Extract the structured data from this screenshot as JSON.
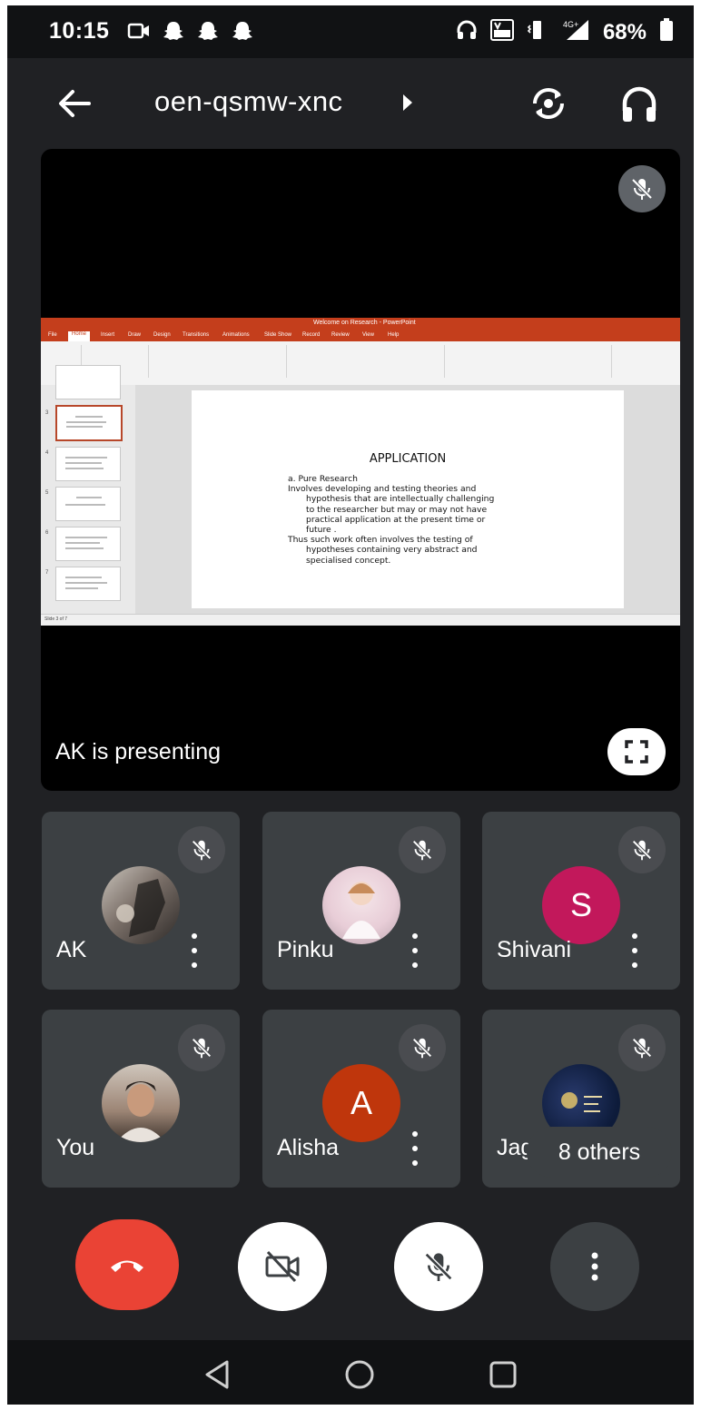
{
  "status_bar": {
    "time": "10:15",
    "battery": "68%",
    "network": "4G+",
    "icons_left": [
      "video-notification-icon",
      "snapchat-icon",
      "snapchat-icon",
      "snapchat-icon"
    ],
    "icons_right": [
      "headset-icon",
      "volte-icon",
      "vibrate-icon",
      "signal-icon",
      "battery-icon"
    ]
  },
  "top_bar": {
    "meeting_code": "oen-qsmw-xnc"
  },
  "presentation": {
    "presenter_label": "AK is presenting",
    "screen": {
      "app_title": "Welcome on Research - PowerPoint",
      "tabs": [
        "File",
        "Home",
        "Insert",
        "Draw",
        "Design",
        "Transitions",
        "Animations",
        "Slide Show",
        "Record",
        "Review",
        "View",
        "Help"
      ],
      "slide_title": "APPLICATION",
      "slide_lines": [
        "a.   Pure Research",
        "Involves developing and testing theories and",
        "hypothesis that are intellectually challenging",
        "to the researcher but may or may not have",
        "practical application at the present time or",
        "future .",
        "Thus such work often involves the testing of",
        "hypotheses containing very abstract and",
        "specialised concept."
      ],
      "thumb_numbers": [
        "3",
        "4",
        "5",
        "6",
        "7"
      ],
      "status_text": "Slide 3 of 7"
    }
  },
  "participants": [
    {
      "name": "AK",
      "initial": "",
      "avatar_color": "#6b6f74",
      "avatar_type": "photo"
    },
    {
      "name": "Pinku",
      "initial": "",
      "avatar_color": "#d9c7d1",
      "avatar_type": "photo"
    },
    {
      "name": "Shivani",
      "initial": "S",
      "avatar_color": "#c2185b",
      "avatar_type": "letter"
    },
    {
      "name": "You",
      "initial": "",
      "avatar_color": "#8a7566",
      "avatar_type": "photo"
    },
    {
      "name": "Alisha",
      "initial": "A",
      "avatar_color": "#bf360c",
      "avatar_type": "letter"
    },
    {
      "name": "Jag",
      "initial": "",
      "avatar_color": "#0d1b3a",
      "avatar_type": "photo"
    }
  ],
  "others_pill": "8 others",
  "controls": {
    "end_call_color": "#ea4335"
  }
}
